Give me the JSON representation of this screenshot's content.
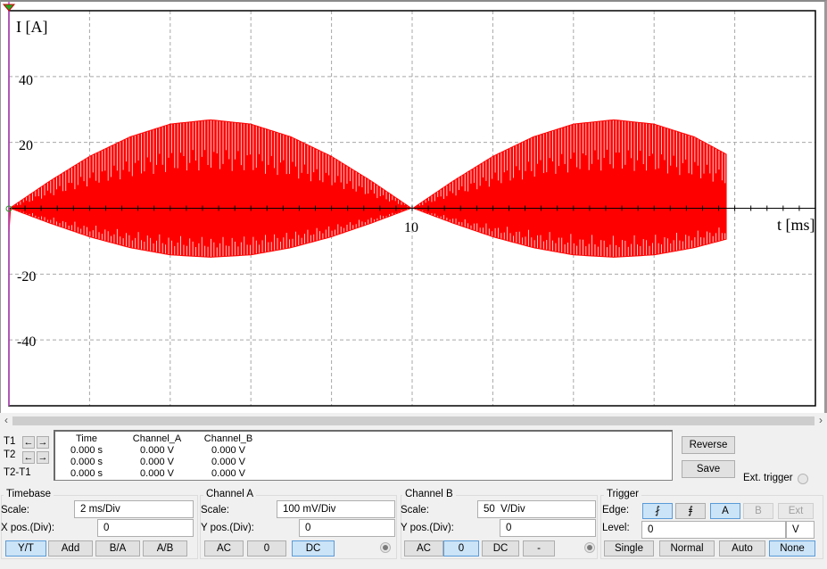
{
  "scope": {
    "y_axis_label": "I [A]",
    "x_axis_label": "t [ms]",
    "y_tick_labels": [
      "40",
      "20",
      "-20",
      "-40"
    ],
    "x_tick_labels": [
      "10"
    ]
  },
  "chart_data": {
    "type": "line",
    "title": "",
    "xlabel": "t [ms]",
    "ylabel": "I [A]",
    "xlim": [
      0,
      20
    ],
    "ylim": [
      -60,
      60
    ],
    "x_major_ticks": [
      0,
      2,
      4,
      6,
      8,
      10,
      12,
      14,
      16,
      18,
      20
    ],
    "y_major_ticks": [
      -60,
      -40,
      -20,
      0,
      20,
      40,
      60
    ],
    "y_tick_labels": [
      "40",
      "20",
      "-20",
      "-40"
    ],
    "x_tick_labels": [
      "10"
    ],
    "grid": true,
    "series": [
      {
        "name": "I",
        "color": "#ff0000",
        "description": "high-frequency switching current under half-sine envelope (rectified 50 Hz)",
        "envelope_period_ms": 10,
        "envelope_max_A": 27,
        "envelope_min_A": -15,
        "t_start_ms": 0,
        "t_end_ms": 17.8,
        "envelope_samples": {
          "t_ms": [
            0,
            1,
            2,
            3,
            4,
            5,
            6,
            7,
            8,
            9,
            10,
            11,
            12,
            13,
            14,
            15,
            16,
            17,
            17.8
          ],
          "upper_A": [
            0,
            8.3,
            15.9,
            21.8,
            25.7,
            27,
            25.7,
            21.8,
            15.9,
            8.3,
            0,
            8.3,
            15.9,
            21.8,
            25.7,
            27,
            25.7,
            21.8,
            16.5
          ],
          "lower_A": [
            0,
            -4.6,
            -8.8,
            -12.1,
            -14.3,
            -15,
            -14.3,
            -12.1,
            -8.8,
            -4.6,
            0,
            -4.6,
            -8.8,
            -12.1,
            -14.3,
            -15,
            -14.3,
            -12.1,
            -9.5
          ]
        }
      }
    ]
  },
  "cursor_panel": {
    "row_labels": [
      "T1",
      "T2",
      "T2-T1"
    ],
    "columns": [
      "Time",
      "Channel_A",
      "Channel_B"
    ],
    "rows": [
      [
        "0.000 s",
        "0.000 V",
        "0.000 V"
      ],
      [
        "0.000 s",
        "0.000 V",
        "0.000 V"
      ],
      [
        "0.000 s",
        "0.000 V",
        "0.000 V"
      ]
    ],
    "reverse_label": "Reverse",
    "save_label": "Save",
    "ext_trigger_label": "Ext. trigger"
  },
  "timebase": {
    "title": "Timebase",
    "scale_label": "Scale:",
    "scale_value": "2 ms/Div",
    "xpos_label": "X pos.(Div):",
    "xpos_value": "0",
    "modes": [
      "Y/T",
      "Add",
      "B/A",
      "A/B"
    ],
    "active_mode": "Y/T"
  },
  "channel_a": {
    "title": "Channel A",
    "scale_label": "Scale:",
    "scale_value": "100 mV/Div",
    "ypos_label": "Y pos.(Div):",
    "ypos_value": "0",
    "coupling": [
      "AC",
      "0",
      "DC"
    ],
    "active_coupling": "DC"
  },
  "channel_b": {
    "title": "Channel B",
    "scale_label": "Scale:",
    "scale_value": "50  V/Div",
    "ypos_label": "Y pos.(Div):",
    "ypos_value": "0",
    "coupling": [
      "AC",
      "0",
      "DC",
      "-"
    ],
    "active_coupling": "0"
  },
  "trigger": {
    "title": "Trigger",
    "edge_label": "Edge:",
    "rising_icon": "rising-edge-icon",
    "falling_icon": "falling-edge-icon",
    "sources": [
      "A",
      "B",
      "Ext"
    ],
    "active_source": "A",
    "level_label": "Level:",
    "level_value": "0",
    "level_unit": "V",
    "modes": [
      "Single",
      "Normal",
      "Auto",
      "None"
    ],
    "active_mode": "None"
  }
}
